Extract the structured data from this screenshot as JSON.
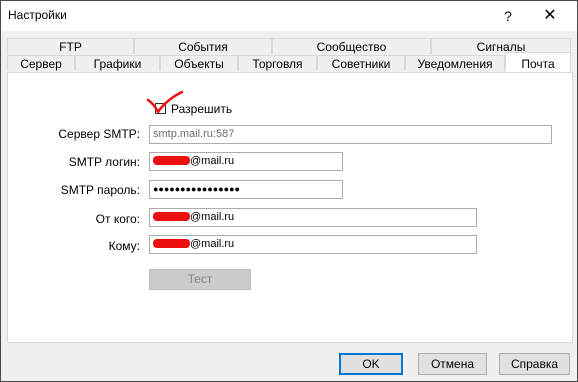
{
  "window": {
    "title": "Настройки",
    "help_glyph": "?",
    "close_glyph": "✕"
  },
  "tabs_back": [
    "FTP",
    "События",
    "Сообщество",
    "Сигналы"
  ],
  "tabs_front": [
    "Сервер",
    "Графики",
    "Объекты",
    "Торговля",
    "Советники",
    "Уведомления",
    "Почта"
  ],
  "active_tab": "Почта",
  "mail": {
    "enable_label": "Разрешить",
    "enabled": true,
    "smtp_server_label": "Сервер SMTP:",
    "smtp_server_value": "smtp.mail.ru:587",
    "smtp_login_label": "SMTP логин:",
    "smtp_login_value": "@mail.ru",
    "smtp_password_label": "SMTP пароль:",
    "smtp_password_value": "●●●●●●●●●●●●●●●●",
    "from_label": "От кого:",
    "from_value": "@mail.ru",
    "to_label": "Кому:",
    "to_value": "@mail.ru",
    "test_label": "Тест"
  },
  "buttons": {
    "ok": "OK",
    "cancel": "Отмена",
    "help": "Справка"
  },
  "colors": {
    "redaction": "#ea1010",
    "default_button_border": "#0078d7"
  }
}
